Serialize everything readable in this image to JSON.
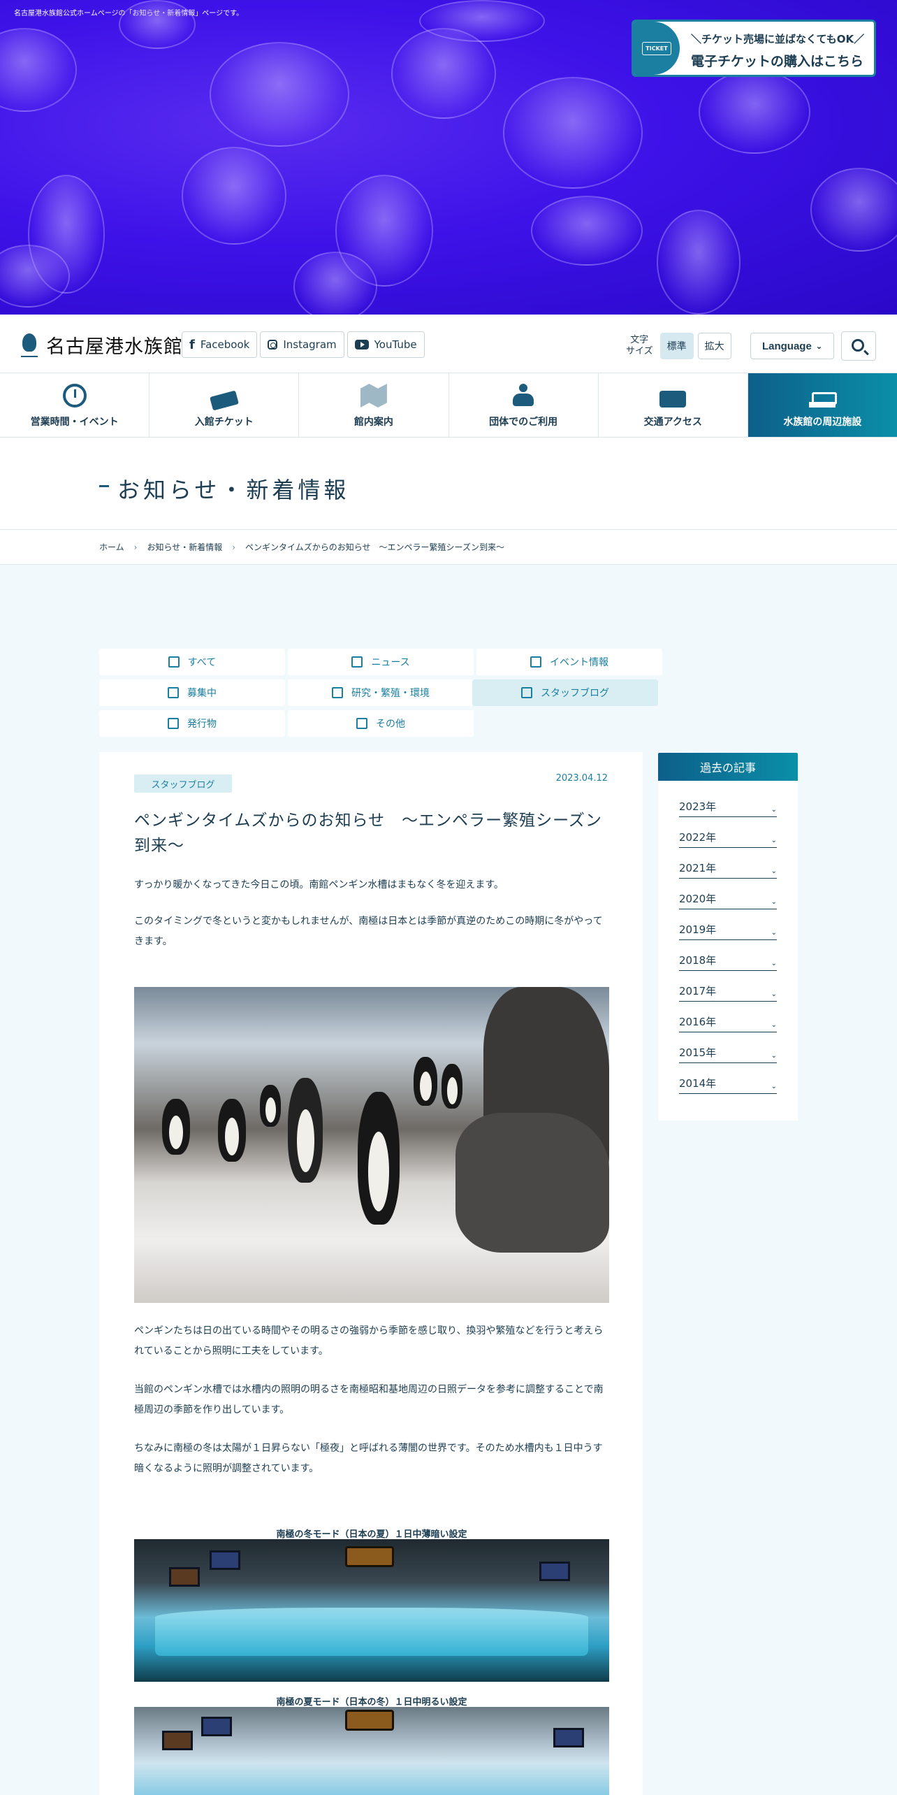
{
  "hero": {
    "top_note": "名古屋港水族館公式ホームページの「お知らせ・新着情報」ページです。",
    "ticket_banner": {
      "tab": "TICKET",
      "line1": "＼チケット売場に並ばなくてもOK／",
      "line2": "電子チケットの購入はこちら"
    }
  },
  "header": {
    "logo_text": "名古屋港水族館",
    "sns": [
      "Facebook",
      "Instagram",
      "YouTube"
    ],
    "font_size_label_1": "文字",
    "font_size_label_2": "サイズ",
    "font_normal": "標準",
    "font_large": "拡大",
    "language": "Language",
    "language_chevron": "⌄"
  },
  "gnav": [
    {
      "label": "営業時間・イベント",
      "icon": "clock-icon"
    },
    {
      "label": "入館チケット",
      "icon": "ticket-icon"
    },
    {
      "label": "館内案内",
      "icon": "map-search-icon"
    },
    {
      "label": "団体でのご利用",
      "icon": "group-icon"
    },
    {
      "label": "交通アクセス",
      "icon": "train-icon"
    },
    {
      "label": "水族館の周辺施設",
      "icon": "ship-icon"
    }
  ],
  "page_title": "お知らせ・新着情報",
  "breadcrumb": [
    "ホーム",
    "お知らせ・新着情報",
    "ペンギンタイムズからのお知らせ　～エンペラー繁殖シーズン到来～"
  ],
  "breadcrumb_sep": "›",
  "categories": [
    {
      "label": "すべて",
      "active": false
    },
    {
      "label": "ニュース",
      "active": false
    },
    {
      "label": "イベント情報",
      "active": false
    },
    {
      "label": "募集中",
      "active": false
    },
    {
      "label": "研究・繁殖・環境",
      "active": false
    },
    {
      "label": "スタッフブログ",
      "active": true
    },
    {
      "label": "発行物",
      "active": false
    },
    {
      "label": "その他",
      "active": false
    }
  ],
  "article": {
    "tag": "スタッフブログ",
    "date": "2023.04.12",
    "title": "ペンギンタイムズからのお知らせ　～エンペラー繁殖シーズン到来～",
    "p1": "すっかり暖かくなってきた今日この頃。南館ペンギン水槽はまもなく冬を迎えます。",
    "p2": "このタイミングで冬というと変かもしれませんが、南極は日本とは季節が真逆のためこの時期に冬がやってきます。",
    "p3": "ペンギンたちは日の出ている時間やその明るさの強弱から季節を感じ取り、換羽や繁殖などを行うと考えられていることから照明に工夫をしています。",
    "p4": "当館のペンギン水槽では水槽内の照明の明るさを南極昭和基地周辺の日照データを参考に調整することで南極周辺の季節を作り出しています。",
    "p5": "ちなみに南極の冬は太陽が１日昇らない「極夜」と呼ばれる薄闇の世界です。そのため水槽内も１日中うす暗くなるように照明が調整されています。",
    "caption1": "南極の冬モード（日本の夏）１日中薄暗い設定",
    "caption2": "南極の夏モード（日本の冬）１日中明るい設定"
  },
  "sidebar": {
    "heading": "過去の記事",
    "years": [
      "2023年",
      "2022年",
      "2021年",
      "2020年",
      "2019年",
      "2018年",
      "2017年",
      "2016年",
      "2015年",
      "2014年"
    ],
    "chevron": "⌄"
  },
  "colors": {
    "primary": "#1c3d52",
    "accent": "#1a7fa0",
    "hero_bg": "#3d12e8",
    "active_tab_bg": "#d9eef3"
  }
}
